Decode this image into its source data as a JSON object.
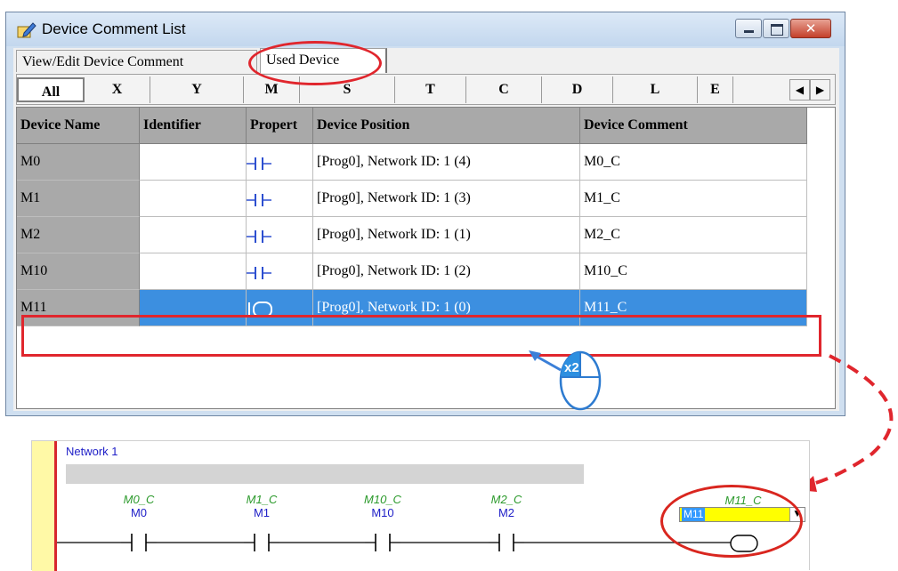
{
  "window": {
    "title": "Device Comment List",
    "controls": {
      "close_glyph": "✕"
    }
  },
  "tabs": [
    {
      "label": "View/Edit Device Comment",
      "active": false
    },
    {
      "label": "Used Device",
      "active": true
    }
  ],
  "device_types": [
    "All",
    "X",
    "Y",
    "M",
    "S",
    "T",
    "C",
    "D",
    "L",
    "E"
  ],
  "device_types_selected": "All",
  "table": {
    "columns": [
      "Device Name",
      "Identifier",
      "Propert",
      "Device Position",
      "Device Comment"
    ],
    "rows": [
      {
        "name": "M0",
        "identifier": "",
        "property": "contact",
        "position": "[Prog0], Network ID: 1 (4)",
        "comment": "M0_C"
      },
      {
        "name": "M1",
        "identifier": "",
        "property": "contact",
        "position": "[Prog0], Network ID: 1 (3)",
        "comment": "M1_C"
      },
      {
        "name": "M2",
        "identifier": "",
        "property": "contact",
        "position": "[Prog0], Network ID: 1 (1)",
        "comment": "M2_C"
      },
      {
        "name": "M10",
        "identifier": "",
        "property": "contact",
        "position": "[Prog0], Network ID: 1 (2)",
        "comment": "M10_C"
      },
      {
        "name": "M11",
        "identifier": "",
        "property": "coil",
        "position": "[Prog0], Network ID: 1 (0)",
        "comment": "M11_C",
        "selected": true
      }
    ]
  },
  "double_click_badge": "x2",
  "ladder": {
    "network_label": "Network 1",
    "contacts": [
      {
        "comment": "M0_C",
        "device": "M0"
      },
      {
        "comment": "M1_C",
        "device": "M1"
      },
      {
        "comment": "M10_C",
        "device": "M10"
      },
      {
        "comment": "M2_C",
        "device": "M2"
      }
    ],
    "coil": {
      "comment": "M11_C",
      "input_value": "M11"
    }
  },
  "colors": {
    "highlight_red": "#e0262d",
    "selection_blue": "#3c8fe0",
    "comment_green": "#2c9a2c",
    "device_blue": "#2020c8",
    "coil_input_yellow": "#ffff00"
  }
}
